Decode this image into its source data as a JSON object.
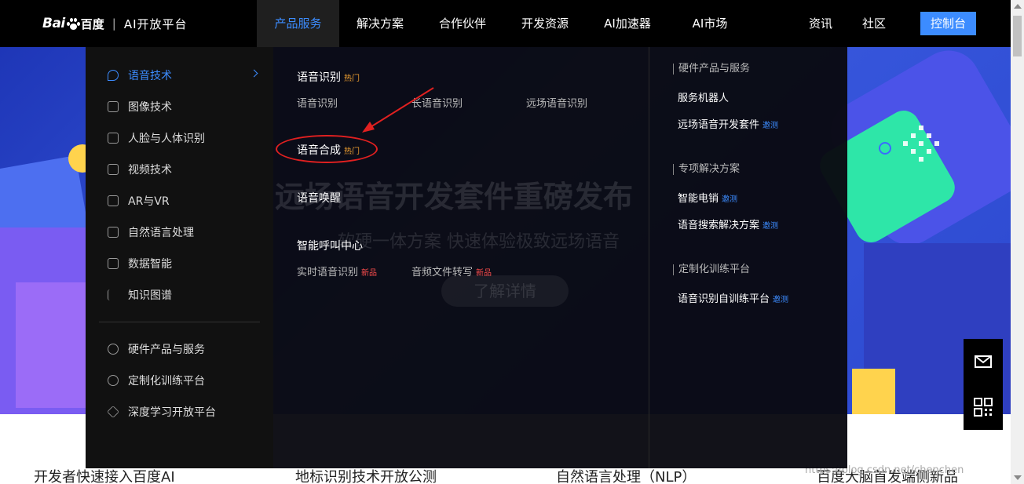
{
  "header": {
    "logo_bai": "Bai",
    "logo_baidu": "百度",
    "logo_sep": "|",
    "logo_platform": "AI开放平台",
    "nav": [
      "产品服务",
      "解决方案",
      "合作伙伴",
      "开发资源",
      "AI加速器",
      "AI市场"
    ],
    "right_nav": [
      "资讯",
      "社区"
    ],
    "console": "控制台"
  },
  "menu": {
    "left": [
      "语音技术",
      "图像技术",
      "人脸与人体识别",
      "视频技术",
      "AR与VR",
      "自然语言处理",
      "数据智能",
      "知识图谱"
    ],
    "left2": [
      "硬件产品与服务",
      "定制化训练平台",
      "深度学习开放平台"
    ],
    "mid": {
      "s1_title": "语音识别",
      "hot": "热门",
      "s1_links": [
        "语音识别",
        "长语音识别",
        "远场语音识别"
      ],
      "s2_title": "语音合成",
      "s3_title": "语音唤醒",
      "s4_title": "智能呼叫中心",
      "s4_links": [
        "实时语音识别",
        "音频文件转写"
      ],
      "new": "新品"
    },
    "right": {
      "h1": "硬件产品与服务",
      "h1_links": [
        "服务机器人",
        "远场语音开发套件"
      ],
      "h2": "专项解决方案",
      "h2_links": [
        "智能电销",
        "语音搜索解决方案"
      ],
      "h3": "定制化训练平台",
      "h3_links": [
        "语音识别自训练平台"
      ],
      "invite": "邀测"
    }
  },
  "hero": {
    "title": "远场语音开发套件重磅发布",
    "subtitle": "软硬一体方案  快速体验极致远场语音",
    "cta": "了解详情"
  },
  "bottom": [
    "开发者快速接入百度AI",
    "地标识别技术开放公测",
    "自然语言处理（NLP）",
    "百度大脑首发端侧新品"
  ],
  "watermark": "https://blog.csdn.net/chenchen",
  "colors": {
    "accent": "#3c8cff",
    "hot": "#f0a030",
    "new": "#ff4d4d",
    "annotation": "#e02020"
  }
}
